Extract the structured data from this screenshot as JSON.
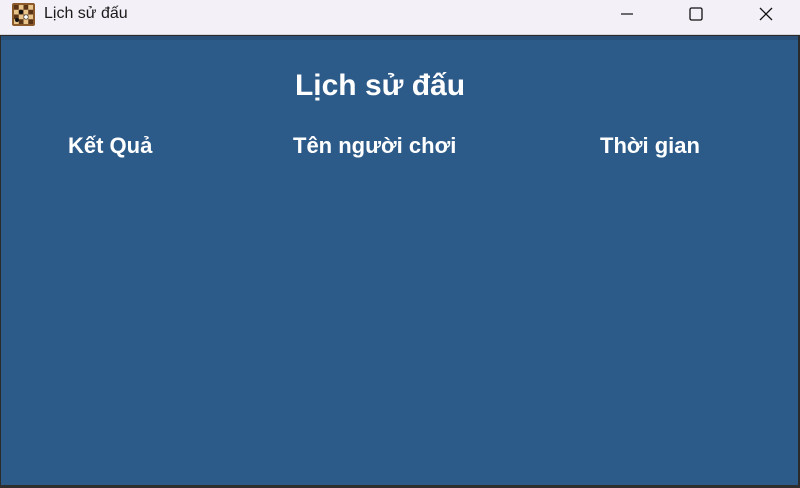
{
  "window": {
    "title": "Lịch sử đấu",
    "icon": "chessboard-icon",
    "controls": {
      "minimize": "minimize-icon",
      "maximize": "maximize-icon",
      "close": "close-icon"
    }
  },
  "page": {
    "heading": "Lịch sử đấu",
    "columns": [
      {
        "label": "Kết Quả"
      },
      {
        "label": "Tên người chơi"
      },
      {
        "label": "Thời gian"
      }
    ],
    "rows": []
  },
  "colors": {
    "content_background": "#2d5b89",
    "titlebar_background": "#f3f0f7",
    "text": "#ffffff"
  }
}
